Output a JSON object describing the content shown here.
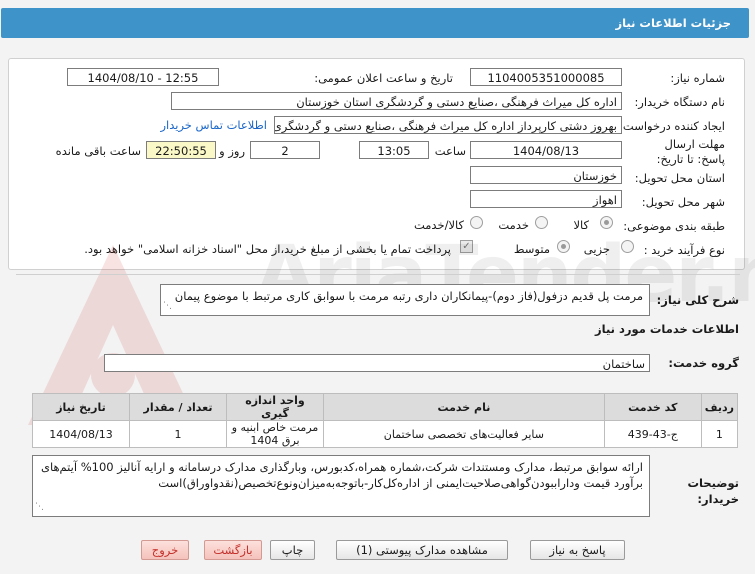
{
  "header": {
    "title": "جزئیات اطلاعات نیاز"
  },
  "fields": {
    "need_number_label": "شماره نیاز:",
    "need_number": "1104005351000085",
    "announce_label": "تاریخ و ساعت اعلان عمومی:",
    "announce_value": "1404/08/10 - 12:55",
    "buyer_org_label": "نام دستگاه خریدار:",
    "buyer_org": "اداره کل میراث فرهنگی ،صنایع دستی و گردشگری استان خوزستان",
    "creator_label": "ایجاد کننده درخواست:",
    "creator": "بهروز دشتی کارپرداز اداره کل میراث فرهنگی ،صنایع دستی و گردشگری استان خوزستان",
    "contact_link": "اطلاعات تماس خریدار",
    "deadline_label": "مهلت ارسال پاسخ: تا تاریخ:",
    "deadline_date": "1404/08/13",
    "time_label": "ساعت",
    "deadline_time": "13:05",
    "days_value": "2",
    "days_label": "روز و",
    "remaining_time": "22:50:55",
    "remaining_label": "ساعت باقی مانده",
    "province_label": "استان محل تحویل:",
    "province": "خوزستان",
    "city_label": "شهر محل تحویل:",
    "city": "اهواز",
    "category_label": "طبقه بندی موضوعی:",
    "category_options": [
      "کالا",
      "خدمت",
      "کالا/خدمت"
    ],
    "process_label": "نوع فرآیند خرید :",
    "process_options": [
      "جزیی",
      "متوسط"
    ],
    "payment_note": "پرداخت تمام یا بخشی از مبلغ خرید،از محل \"اسناد خزانه اسلامی\" خواهد بود."
  },
  "summary": {
    "label": "شرح کلی نیاز:",
    "text": "مرمت پل قدیم دزفول(فاز دوم)-پیمانکاران داری رتبه مرمت با سوابق کاری مرتبط با موضوع پیمان"
  },
  "services": {
    "section_title": "اطلاعات خدمات مورد نیاز",
    "group_label": "گروه خدمت:",
    "group_value": "ساختمان",
    "columns": [
      "ردیف",
      "کد خدمت",
      "نام خدمت",
      "واحد اندازه گیری",
      "تعداد / مقدار",
      "تاریخ نیاز"
    ],
    "rows": [
      [
        "1",
        "ج-43-439",
        "سایر فعالیت‌های تخصصی ساختمان",
        "مرمت خاص ابنیه و برق 1404",
        "1",
        "1404/08/13"
      ]
    ]
  },
  "buyer_notes": {
    "label": "توضیحات خریدار:",
    "text": "ارائه سوابق مرتبط، مدارک ومستندات شرکت،شماره همراه،کدبورس، وبارگذاری مدارک درسامانه و ارایه آنالیز 100% آیتم‌های برآورد قیمت وداراببودن‌گواهی‌صلاحیت‌ایمنی از اداره‌کل‌کار-باتوجه‌به‌میزان‌ونوع‌تخصیص(نقدواوراق)است"
  },
  "buttons": {
    "reply": "پاسخ به نیاز",
    "attachments": "مشاهده مدارک پیوستی (1)",
    "print": "چاپ",
    "back": "بازگشت",
    "exit": "خروج"
  },
  "colors": {
    "header": "#3e93c8",
    "link": "#1b67c9",
    "highlight": "#fbf8c8",
    "exit": "#c4302b"
  }
}
